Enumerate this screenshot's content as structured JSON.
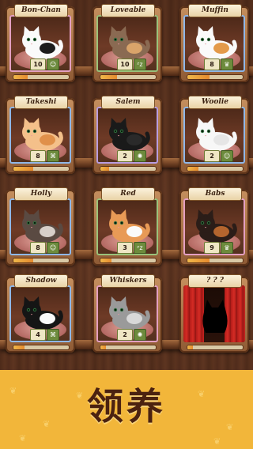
{
  "colors": {
    "shelf": "#7c4a29",
    "accent": "#f2b63a",
    "level_bar": "#e58a2e"
  },
  "cats": [
    {
      "name": "Bon-Chan",
      "level": "10",
      "trait_icon": "smile-icon",
      "trait_glyph": "☺",
      "frame": "pink",
      "progress": 0.25,
      "fur": [
        "#fafafa",
        "#1c1c1c"
      ]
    },
    {
      "name": "Loveable",
      "level": "10",
      "trait_icon": "sleep-icon",
      "trait_glyph": "ᶻz",
      "frame": "green",
      "progress": 0.3,
      "fur": [
        "#8a6a52",
        "#d9a46a"
      ]
    },
    {
      "name": "Muffin",
      "level": "8",
      "trait_icon": "crown-icon",
      "trait_glyph": "♛",
      "frame": "blue",
      "progress": 0.4,
      "fur": [
        "#fafafa",
        "#e39a4a"
      ]
    },
    {
      "name": "Takeshi",
      "level": "8",
      "trait_icon": "paw-box-icon",
      "trait_glyph": "⌘",
      "frame": "blue",
      "progress": 0.35,
      "fur": [
        "#f4c08a",
        "#e0904a"
      ]
    },
    {
      "name": "Salem",
      "level": "2",
      "trait_icon": "yarn-icon",
      "trait_glyph": "✺",
      "frame": "purple",
      "progress": 0.15,
      "fur": [
        "#1a1a1a",
        "#2a2a2a"
      ]
    },
    {
      "name": "Woolie",
      "level": "2",
      "trait_icon": "smile-icon",
      "trait_glyph": "☺",
      "frame": "blue",
      "progress": 0.2,
      "fur": [
        "#f7f7f7",
        "#e6e6e6"
      ]
    },
    {
      "name": "Holly",
      "level": "8",
      "trait_icon": "smile-icon",
      "trait_glyph": "☺",
      "frame": "blue",
      "progress": 0.35,
      "fur": [
        "#5a4a42",
        "#d7cfc9"
      ]
    },
    {
      "name": "Red",
      "level": "3",
      "trait_icon": "sleep-icon",
      "trait_glyph": "ᶻz",
      "frame": "green",
      "progress": 0.2,
      "fur": [
        "#e89a56",
        "#fafafa"
      ]
    },
    {
      "name": "Babs",
      "level": "9",
      "trait_icon": "crown-icon",
      "trait_glyph": "♛",
      "frame": "pink",
      "progress": 0.4,
      "fur": [
        "#2b1d18",
        "#b4652e"
      ]
    },
    {
      "name": "Shadow",
      "level": "4",
      "trait_icon": "paw-box-icon",
      "trait_glyph": "⌘",
      "frame": "blue",
      "progress": 0.2,
      "fur": [
        "#151515",
        "#fafafa"
      ]
    },
    {
      "name": "Whiskers",
      "level": "2",
      "trait_icon": "yarn-icon",
      "trait_glyph": "✺",
      "frame": "pink",
      "progress": 0.1,
      "fur": [
        "#9a9a9a",
        "#d8d8d8"
      ]
    }
  ],
  "locked_slot": {
    "name": "? ? ?",
    "progress": 0.1
  },
  "adopt_label": "领养"
}
